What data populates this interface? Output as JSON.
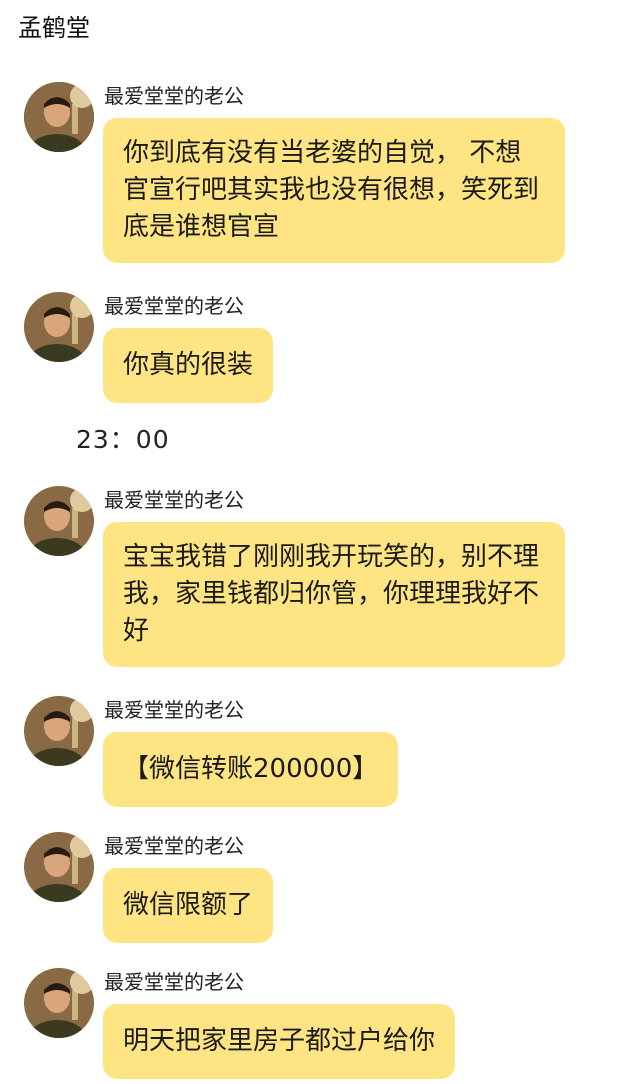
{
  "header": {
    "title": "孟鹤堂"
  },
  "timestamp": "23：00",
  "messages": [
    {
      "sender": "最爱堂堂的老公",
      "text": "你到底有没有当老婆的自觉， 不想官宣行吧其实我也没有很想，笑死到底是谁想官宣"
    },
    {
      "sender": "最爱堂堂的老公",
      "text": "你真的很装"
    },
    {
      "sender": "最爱堂堂的老公",
      "text": "宝宝我错了刚刚我开玩笑的，别不理我，家里钱都归你管，你理理我好不好"
    },
    {
      "sender": "最爱堂堂的老公",
      "text": "【微信转账200000】"
    },
    {
      "sender": "最爱堂堂的老公",
      "text": "微信限额了"
    },
    {
      "sender": "最爱堂堂的老公",
      "text": "明天把家里房子都过户给你"
    }
  ],
  "colors": {
    "bubble": "#fee482",
    "background": "#ffffff"
  }
}
